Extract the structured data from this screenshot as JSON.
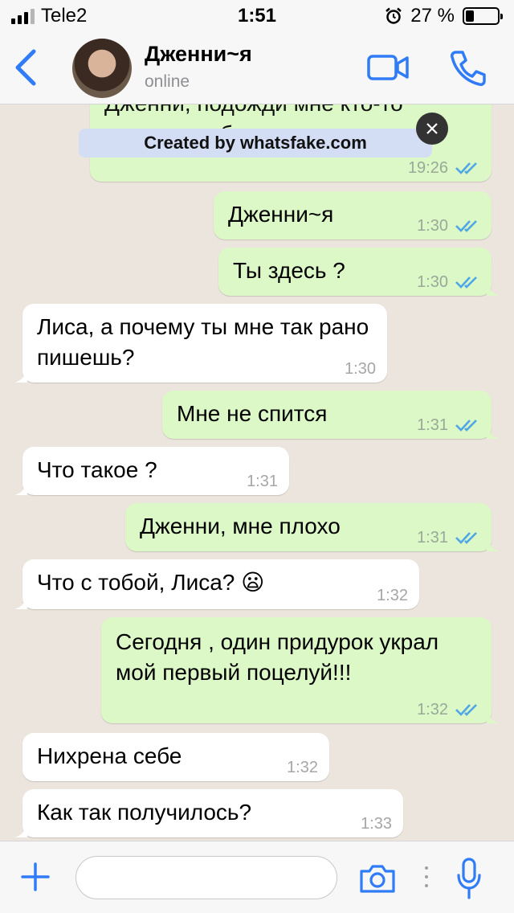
{
  "status_bar": {
    "carrier": "Tele2",
    "time": "1:51",
    "battery": "27 %",
    "battery_level": 0.27
  },
  "header": {
    "contact_name": "Дженни~я",
    "contact_status": "online"
  },
  "watermark": {
    "text": "Created by whatsfake.com"
  },
  "messages": [
    {
      "direction": "out",
      "text": "Дженни, подожди мне кто-то пишет, я тебе позже напишу",
      "time": "19:26",
      "read": true
    },
    {
      "direction": "out",
      "text": "Дженни~я",
      "time": "1:30",
      "read": true
    },
    {
      "direction": "out",
      "text": "Ты здесь ?",
      "time": "1:30",
      "read": true
    },
    {
      "direction": "in",
      "text": "Лиса, а почему ты мне так рано пишешь?",
      "time": "1:30"
    },
    {
      "direction": "out",
      "text": "Мне не спится",
      "time": "1:31",
      "read": true
    },
    {
      "direction": "in",
      "text": "Что такое ?",
      "time": "1:31"
    },
    {
      "direction": "out",
      "text": "Дженни, мне плохо",
      "time": "1:31",
      "read": true
    },
    {
      "direction": "in",
      "text": "Что с тобой, Лиса?",
      "emoji": "😦",
      "time": "1:32"
    },
    {
      "direction": "out",
      "text": "Сегодня , один придурок украл мой первый поцелуй!!!",
      "time": "1:32",
      "read": true
    },
    {
      "direction": "in",
      "text": "Нихрена себе",
      "time": "1:32"
    },
    {
      "direction": "in",
      "text": "Как так получилось?",
      "time": "1:33"
    }
  ],
  "composer": {
    "placeholder": ""
  },
  "colors": {
    "accent": "#2f7cf6",
    "outgoing_bubble": "#dcf8c6",
    "incoming_bubble": "#ffffff",
    "read_ticks": "#4fa7e8",
    "chat_background": "#ece5dd"
  },
  "icons": {
    "back": "chevron-left-icon",
    "video": "video-camera-icon",
    "call": "phone-icon",
    "plus": "plus-icon",
    "camera": "camera-icon",
    "mic": "microphone-icon",
    "alarm": "alarm-clock-icon"
  }
}
